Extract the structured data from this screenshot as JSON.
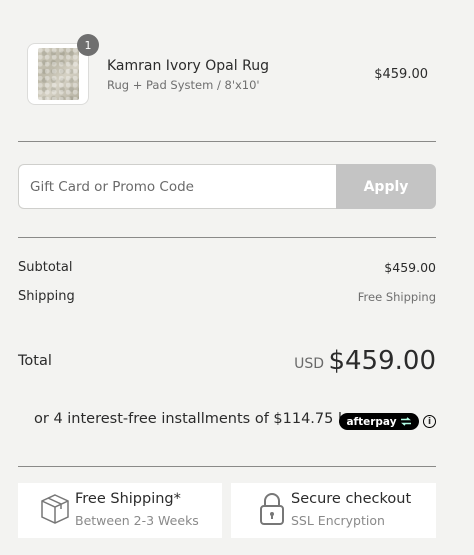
{
  "cart": {
    "item": {
      "quantity": "1",
      "name": "Kamran Ivory Opal Rug",
      "variant": "Rug + Pad System / 8'x10'",
      "price": "$459.00"
    }
  },
  "promo": {
    "placeholder": "Gift Card or Promo Code",
    "apply_label": "Apply"
  },
  "summary": {
    "subtotal_label": "Subtotal",
    "subtotal_value": "$459.00",
    "shipping_label": "Shipping",
    "shipping_value": "Free Shipping",
    "total_label": "Total",
    "currency": "USD",
    "total_value": "$459.00"
  },
  "installments": {
    "text": "or 4 interest-free installments of $114.75 by",
    "provider": "afterpay",
    "info_icon": "info-icon"
  },
  "features": [
    {
      "title": "Free Shipping*",
      "subtitle": "Between 2-3 Weeks",
      "icon": "package-box-icon"
    },
    {
      "title": "Secure checkout",
      "subtitle": "SSL Encryption",
      "icon": "padlock-icon"
    }
  ],
  "colors": {
    "background": "#f3f3f1",
    "apply_button": "#c4c4c4",
    "afterpay_badge": "#000000"
  }
}
